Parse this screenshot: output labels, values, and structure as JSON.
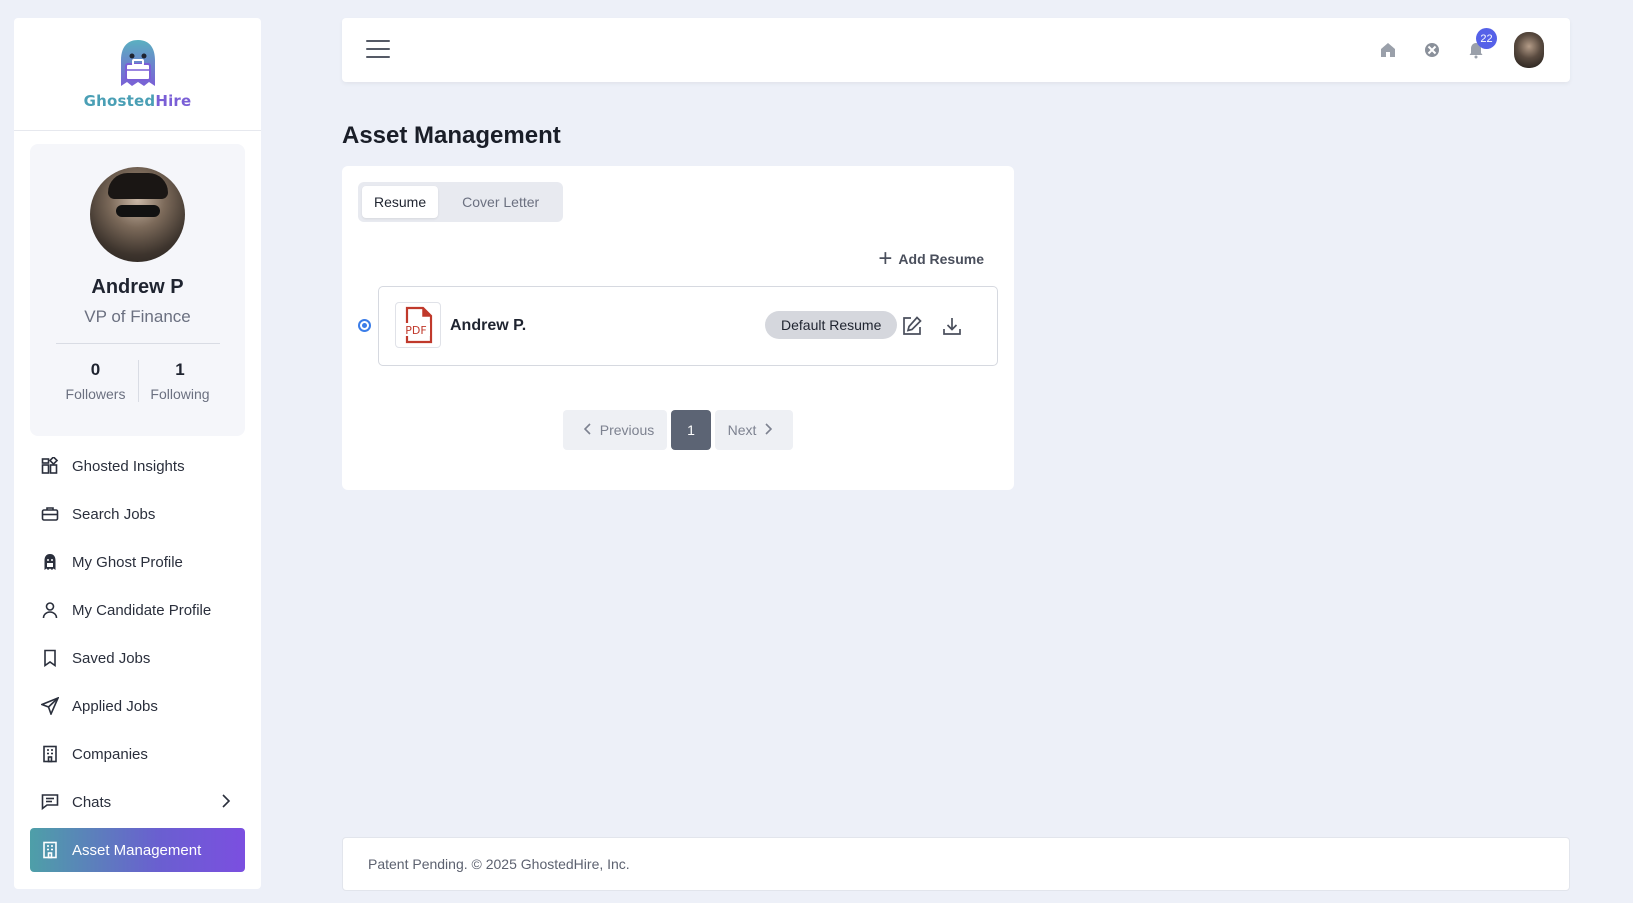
{
  "brand": {
    "name_part1": "Ghosted",
    "name_part2": "Hire"
  },
  "profile": {
    "name": "Andrew P",
    "role": "VP of Finance",
    "followers_count": "0",
    "followers_label": "Followers",
    "following_count": "1",
    "following_label": "Following"
  },
  "nav": {
    "items": [
      {
        "label": "Ghosted Insights",
        "icon": "insights-icon"
      },
      {
        "label": "Search Jobs",
        "icon": "briefcase-icon"
      },
      {
        "label": "My Ghost Profile",
        "icon": "ghost-icon"
      },
      {
        "label": "My Candidate Profile",
        "icon": "user-icon"
      },
      {
        "label": "Saved Jobs",
        "icon": "bookmark-icon"
      },
      {
        "label": "Applied Jobs",
        "icon": "send-icon"
      },
      {
        "label": "Companies",
        "icon": "building-icon"
      },
      {
        "label": "Chats",
        "icon": "chat-icon"
      },
      {
        "label": "Asset Management",
        "icon": "asset-icon"
      }
    ],
    "active_index": 8
  },
  "topbar": {
    "notification_count": "22"
  },
  "page": {
    "title": "Asset Management"
  },
  "tabs": [
    {
      "label": "Resume",
      "active": true
    },
    {
      "label": "Cover Letter",
      "active": false
    }
  ],
  "actions": {
    "add_resume": "Add Resume"
  },
  "resumes": [
    {
      "name": "Andrew P.",
      "badge": "Default Resume",
      "file_type": "PDF"
    }
  ],
  "pagination": {
    "previous": "Previous",
    "current": "1",
    "next": "Next"
  },
  "footer": {
    "text": "Patent Pending. © 2025 GhostedHire, Inc."
  },
  "colors": {
    "accent_start": "#4e9fa8",
    "accent_end": "#7b4fe0",
    "badge": "#5561e8",
    "radio": "#3b7de8",
    "pdf": "#c0392b"
  }
}
